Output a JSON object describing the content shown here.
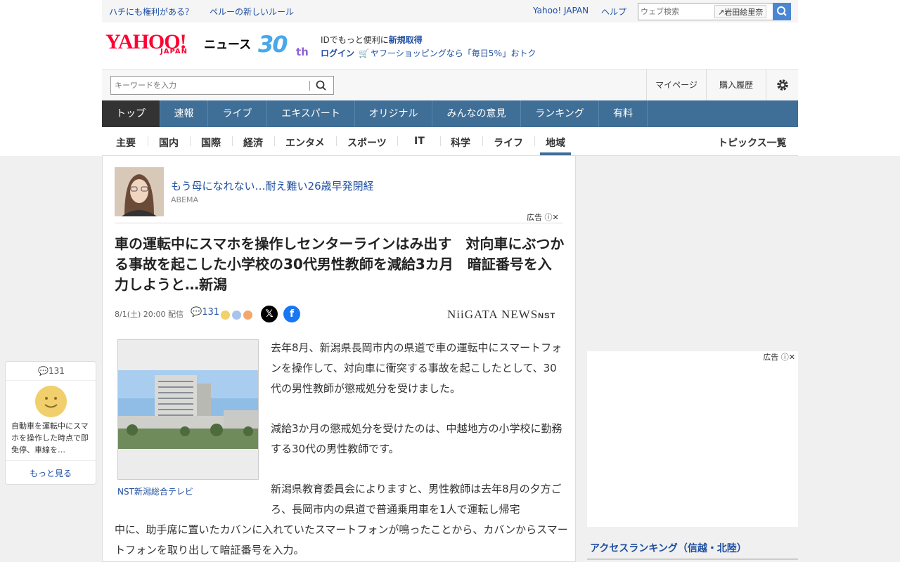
{
  "topbar": {
    "link1": "ハチにも権利がある？",
    "link2": "ペルーの新しいルール",
    "yahoo_japan": "Yahoo! JAPAN",
    "help": "ヘルプ",
    "search_placeholder": "ウェブ検索",
    "search_chip": "岩田絵里奈"
  },
  "header": {
    "logo_text": "YAHOO!",
    "logo_sub": "JAPAN",
    "logo_news": "ニュース",
    "anniv_number": "30",
    "anniv_suffix": "th",
    "id_text": "IDでもっと便利に",
    "register": "新規取得",
    "login": "ログイン",
    "promo": "ヤフーショッピングなら「毎日5％」おトク"
  },
  "search": {
    "placeholder": "キーワードを入力",
    "mypage": "マイページ",
    "history": "購入履歴"
  },
  "main_nav": [
    "トップ",
    "速報",
    "ライブ",
    "エキスパート",
    "オリジナル",
    "みんなの意見",
    "ランキング",
    "有料"
  ],
  "sub_nav": [
    "主要",
    "国内",
    "国際",
    "経済",
    "エンタメ",
    "スポーツ",
    "IT",
    "科学",
    "ライフ",
    "地域"
  ],
  "topics_all": "トピックス一覧",
  "ad": {
    "title": "もう母になれない…耐え難い26歳早発閉経",
    "source": "ABEMA",
    "label": "広告"
  },
  "article": {
    "headline": "車の運転中にスマホを操作しセンターラインはみ出す　対向車にぶつかる事故を起こした小学校の30代男性教師を減給3カ月　暗証番号を入力しようと…新潟",
    "date": "8/1(土) 20:00 配信",
    "comments": "131",
    "publisher": "NiiGATA NEWS",
    "publisher_sub": "NST",
    "photo_caption": "NST新潟総合テレビ",
    "p1": "去年8月、新潟県長岡市内の県道で車の運転中にスマートフォンを操作して、対向車に衝突する事故を起こしたとして、30代の男性教師が懲戒処分を受けました。",
    "p2": "減給3か月の懲戒処分を受けたのは、中越地方の小学校に勤務する30代の男性教師です。",
    "p3a": "新潟県教育委員会によりますと、男性教師は去年8月の夕方ごろ、長岡市内の県道で普通乗用車を1人で運転し帰宅",
    "p3b": "中に、助手席に置いたカバンに入れていたスマートフォンが鳴ったことから、カバンからスマートフォンを取り出して暗証番号を入力。"
  },
  "comment_card": {
    "count": "131",
    "text": "自動車を運転中にスマホを操作した時点で即免停、車線を…",
    "more": "もっと見る"
  },
  "right": {
    "ad_label": "広告",
    "ranking_title": "アクセスランキング（信越・北陸）"
  },
  "colors": {
    "nav": "#3f6e96",
    "link": "#1e4ea1",
    "brand": "#ff0033"
  }
}
